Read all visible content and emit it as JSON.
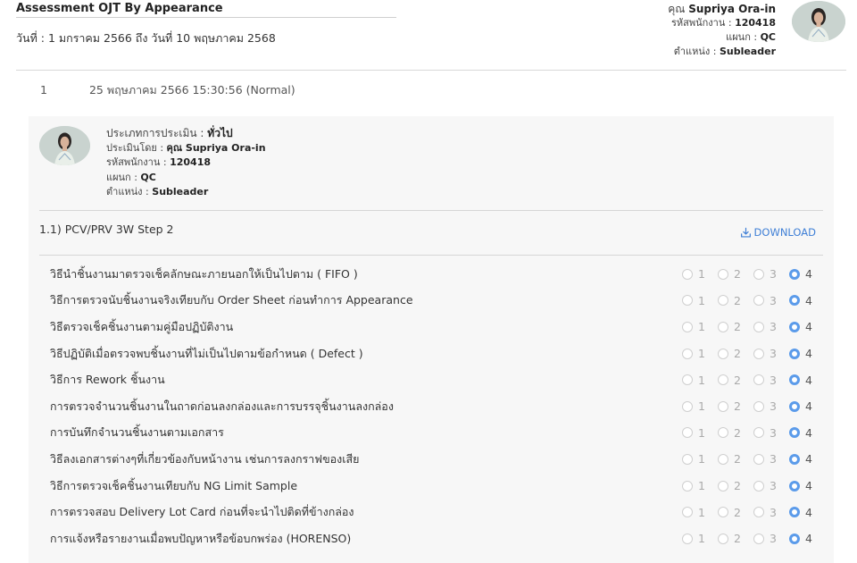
{
  "page": {
    "title": "Assessment OJT By Appearance",
    "date_range": "วันที่ : 1 มกราคม 2566 ถึง วันที่ 10 พฤษภาคม 2568"
  },
  "user": {
    "name_prefix": "คุณ",
    "name": "Supriya Ora-in",
    "employee_id_label": "รหัสพนักงาน :",
    "employee_id": "120418",
    "department_label": "แผนก :",
    "department": "QC",
    "position_label": "ตำแหน่ง :",
    "position": "Subleader"
  },
  "record": {
    "number": "1",
    "timestamp": "25 พฤษภาคม 2566 15:30:56 (Normal)"
  },
  "assessment": {
    "type_label": "ประเภทการประเมิน :",
    "type_value": "ทั่วไป",
    "assessor_label": "ประเมินโดย :",
    "assessor_value": "คุณ Supriya Ora-in",
    "employee_id_label": "รหัสพนักงาน :",
    "employee_id": "120418",
    "department_label": "แผนก :",
    "department": "QC",
    "position_label": "ตำแหน่ง :",
    "position": "Subleader"
  },
  "section": {
    "title": "1.1) PCV/PRV 3W Step 2",
    "download_label": "DOWNLOAD"
  },
  "rating_options": [
    "1",
    "2",
    "3",
    "4"
  ],
  "items": [
    {
      "label": "วิธีนำชิ้นงานมาตรวจเช็คลักษณะภายนอกให้เป็นไปตาม ( FIFO )",
      "selected": "4"
    },
    {
      "label": "วิธีการตรวจนับชิ้นงานจริงเทียบกับ Order Sheet ก่อนทำการ Appearance",
      "selected": "4"
    },
    {
      "label": "วิธีตรวจเช็คชิ้นงานตามคู่มือปฏิบัติงาน",
      "selected": "4"
    },
    {
      "label": "วิธีปฏิบัติเมื่อตรวจพบชิ้นงานที่ไม่เป็นไปตามข้อกำหนด ( Defect )",
      "selected": "4"
    },
    {
      "label": "วิธีการ Rework ชิ้นงาน",
      "selected": "4"
    },
    {
      "label": "การตรวจจำนวนชิ้นงานในถาดก่อนลงกล่องและการบรรจุชิ้นงานลงกล่อง",
      "selected": "4"
    },
    {
      "label": "การบันทึกจำนวนชิ้นงานตามเอกสาร",
      "selected": "4"
    },
    {
      "label": "วิธีลงเอกสารต่างๆที่เกี่ยวข้องกับหน้างาน เช่นการลงกราฟของเสีย",
      "selected": "4"
    },
    {
      "label": "วิธีการตรวจเช็คชิ้นงานเทียบกับ NG Limit Sample",
      "selected": "4"
    },
    {
      "label": "การตรวจสอบ Delivery Lot Card ก่อนที่จะนำไปติดที่ข้างกล่อง",
      "selected": "4"
    },
    {
      "label": "การแจ้งหรือรายงานเมื่อพบปัญหาหรือข้อบกพร่อง (HORENSO)",
      "selected": "4"
    }
  ],
  "colors": {
    "accent": "#5b9bea",
    "link": "#3f7fd6",
    "card_bg": "#f7f7f7"
  },
  "icons": {
    "download": "download-icon",
    "avatar": "avatar-photo"
  }
}
